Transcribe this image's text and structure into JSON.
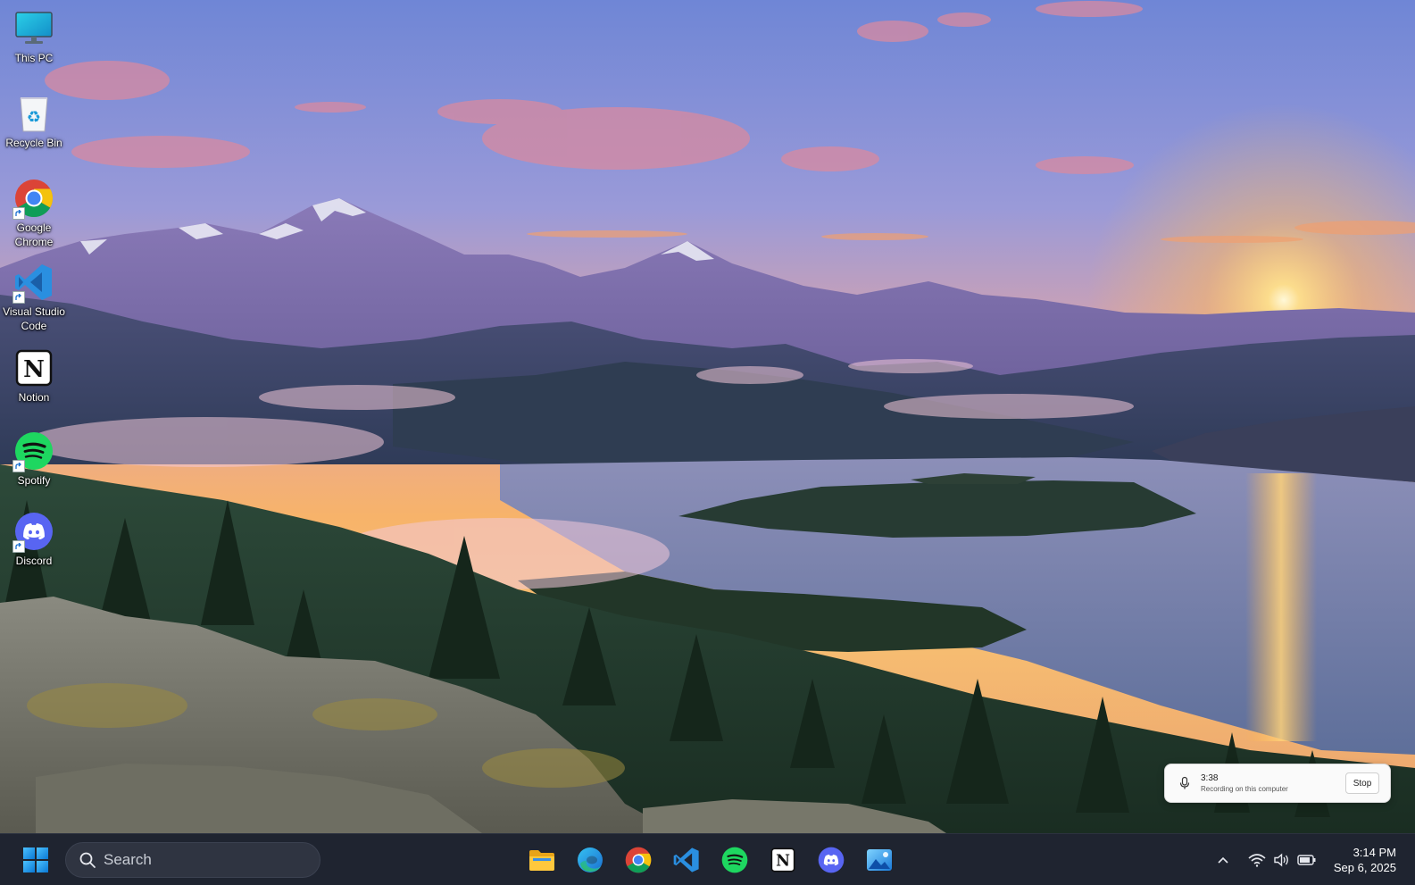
{
  "desktop": {
    "icons": [
      {
        "label": "This PC",
        "icon": "monitor-icon"
      },
      {
        "label": "Recycle Bin",
        "icon": "recycle-bin-icon"
      },
      {
        "label": "Google Chrome",
        "icon": "chrome-icon"
      },
      {
        "label": "Visual Studio Code",
        "icon": "vscode-icon"
      },
      {
        "label": "Notion",
        "icon": "notion-icon"
      },
      {
        "label": "Spotify",
        "icon": "spotify-icon"
      },
      {
        "label": "Discord",
        "icon": "discord-icon"
      }
    ]
  },
  "recording": {
    "time": "3:38",
    "subtitle": "Recording on this computer",
    "stop_label": "Stop"
  },
  "taskbar": {
    "search_placeholder": "Search",
    "pinned": [
      {
        "name": "File Explorer",
        "icon": "folder-icon"
      },
      {
        "name": "Microsoft Edge",
        "icon": "edge-icon"
      },
      {
        "name": "Google Chrome",
        "icon": "chrome-icon"
      },
      {
        "name": "Visual Studio Code",
        "icon": "vscode-icon"
      },
      {
        "name": "Spotify",
        "icon": "spotify-icon"
      },
      {
        "name": "Notion",
        "icon": "notion-icon"
      },
      {
        "name": "Discord",
        "icon": "discord-icon"
      },
      {
        "name": "Photos",
        "icon": "photos-icon"
      }
    ],
    "time": "3:14 PM",
    "date": "Sep 6, 2025"
  },
  "colors": {
    "taskbar_bg": "#1f2430",
    "chrome_red": "#db4437",
    "chrome_yellow": "#f4c20d",
    "chrome_green": "#0f9d58",
    "chrome_blue": "#4285f4",
    "vscode_blue": "#2a8fe0",
    "spotify_green": "#1ed760",
    "discord_blurple": "#5865f2"
  }
}
